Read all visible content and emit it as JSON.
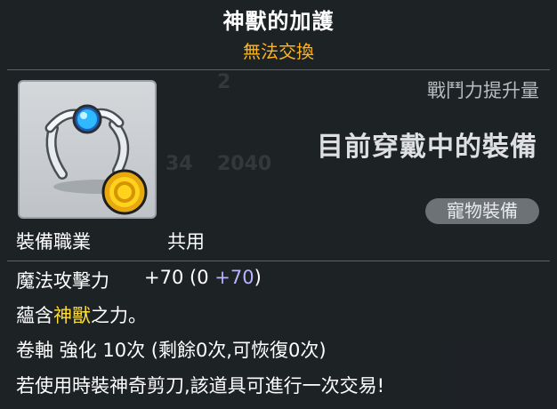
{
  "item": {
    "name": "神獸的加護",
    "trade_status": "無法交換",
    "power_label": "戰鬥力提升量",
    "current_equip_text": "目前穿戴中的裝備",
    "pet_tag": "寵物裝備",
    "icon": "ring-with-blue-gem-and-gold-coin-icon"
  },
  "job": {
    "label": "裝備職業",
    "value": "共用"
  },
  "stats": {
    "magic_attack_label": "魔法攻擊力",
    "magic_attack_total": "+70",
    "magic_attack_open": "(0",
    "magic_attack_bonus": "+70",
    "magic_attack_close": ")"
  },
  "description": {
    "prefix": "蘊含",
    "highlight": "神獸",
    "suffix": "之力。"
  },
  "scroll": {
    "text": "卷軸 強化 10次 (剩餘0次,可恢復0次)"
  },
  "scissors_note": "若使用時裝神奇剪刀,該道具可進行一次交易!",
  "background_ghosts": {
    "a": "2",
    "b": "34",
    "c": "2040"
  },
  "colors": {
    "trade_status": "#ffb41e",
    "highlight": "#ffdd33",
    "bonus": "#b8b4ff",
    "tag_bg": "#6d7277"
  }
}
